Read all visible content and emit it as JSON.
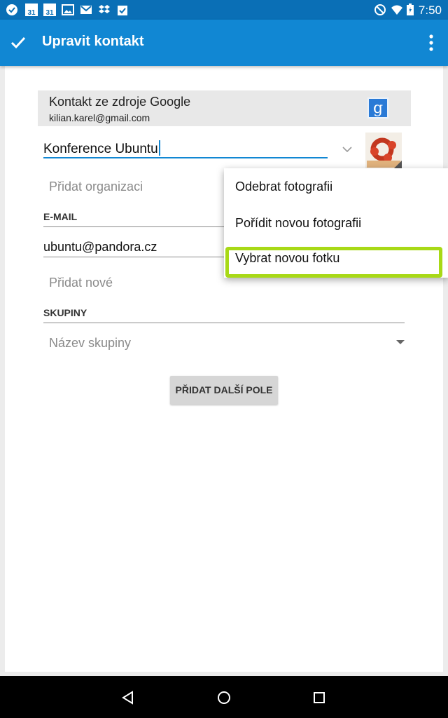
{
  "status_bar": {
    "time": "7:50",
    "left_icons": [
      "check-circle-icon",
      "calendar-icon",
      "calendar-icon",
      "image-icon",
      "gmail-icon",
      "dropbox-icon",
      "clipboard-icon"
    ],
    "calendar_day": "31",
    "right_icons": [
      "do-not-disturb-icon",
      "wifi-icon",
      "battery-charging-icon"
    ]
  },
  "app_bar": {
    "title": "Upravit kontakt"
  },
  "account": {
    "title": "Kontakt ze zdroje Google",
    "email": "kilian.karel@gmail.com",
    "logo_letter": "g"
  },
  "form": {
    "name_value": "Konference Ubuntu",
    "organization_placeholder": "Přidat organizaci",
    "email_section": "E-MAIL",
    "email_value": "ubuntu@pandora.cz",
    "email_add_placeholder": "Přidat nové",
    "groups_section": "SKUPINY",
    "group_placeholder": "Název skupiny",
    "add_field_button": "PŘIDAT DALŠÍ POLE"
  },
  "photo_menu": {
    "items": [
      "Odebrat fotografii",
      "Pořídit novou fotografii",
      "Vybrat novou fotku"
    ],
    "highlighted_index": 2
  },
  "colors": {
    "status_bar": "#0a6fb6",
    "app_bar": "#1187d3",
    "highlight": "#a8d916"
  }
}
